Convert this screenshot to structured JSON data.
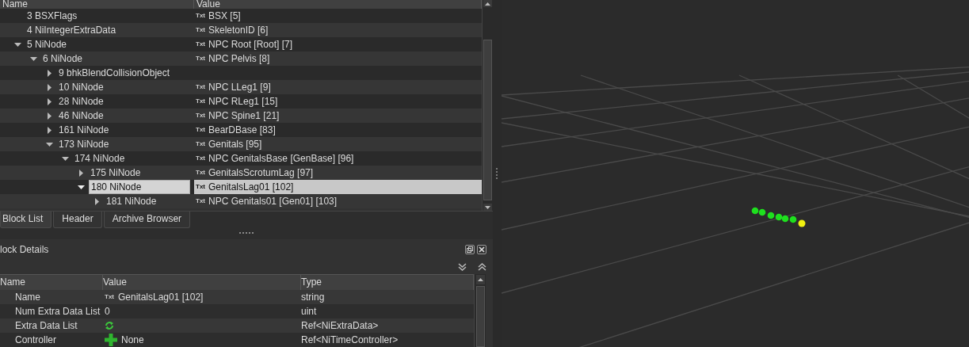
{
  "block_tree": {
    "columns": [
      "Name",
      "Value"
    ],
    "rows": [
      {
        "name": "3 BSXFlags",
        "tag": "Txt",
        "value": "BSX [5]",
        "selected": false
      },
      {
        "name": "4 NiIntegerExtraData",
        "tag": "Txt",
        "value": "SkeletonID [6]",
        "selected": false
      },
      {
        "name": "5 NiNode",
        "tag": "Txt",
        "value": "NPC Root [Root] [7]",
        "selected": false,
        "expanded": true,
        "children": [
          {
            "name": "6 NiNode",
            "tag": "Txt",
            "value": "NPC Pelvis [8]",
            "selected": false,
            "expanded": true,
            "children": [
              {
                "name": "9 bhkBlendCollisionObject",
                "selected": false,
                "expanded": false
              },
              {
                "name": "10 NiNode",
                "tag": "Txt",
                "value": "NPC LLeg1 [9]",
                "selected": false,
                "expanded": false
              },
              {
                "name": "28 NiNode",
                "tag": "Txt",
                "value": "NPC RLeg1 [15]",
                "selected": false,
                "expanded": false
              },
              {
                "name": "46 NiNode",
                "tag": "Txt",
                "value": "NPC Spine1 [21]",
                "selected": false,
                "expanded": false
              },
              {
                "name": "161 NiNode",
                "tag": "Txt",
                "value": "BearDBase [83]",
                "selected": false,
                "expanded": false
              },
              {
                "name": "173 NiNode",
                "tag": "Txt",
                "value": "Genitals [95]",
                "selected": false,
                "expanded": true,
                "children": [
                  {
                    "name": "174 NiNode",
                    "tag": "Txt",
                    "value": "NPC GenitalsBase [GenBase] [96]",
                    "selected": false,
                    "expanded": true,
                    "children": [
                      {
                        "name": "175 NiNode",
                        "tag": "Txt",
                        "value": "GenitalsScrotumLag [97]",
                        "selected": false,
                        "expanded": false
                      },
                      {
                        "name": "180 NiNode",
                        "tag": "Txt",
                        "value": "GenitalsLag01 [102]",
                        "selected": true,
                        "expanded": true,
                        "children": [
                          {
                            "name": "181 NiNode",
                            "tag": "Txt",
                            "value": "NPC Genitals01 [Gen01] [103]",
                            "selected": false,
                            "expanded": false
                          }
                        ]
                      }
                    ]
                  }
                ]
              }
            ]
          }
        ]
      }
    ]
  },
  "tabs": [
    {
      "label": "Block List",
      "selected": true
    },
    {
      "label": "Header",
      "selected": false
    },
    {
      "label": "Archive Browser",
      "selected": false
    }
  ],
  "block_details": {
    "title": "lock Details",
    "columns": [
      "Name",
      "Value",
      "Type"
    ],
    "rows": [
      {
        "name": "Name",
        "kind": "text",
        "tag": "Txt",
        "value": "GenitalsLag01 [102]",
        "type": "string"
      },
      {
        "name": "Num Extra Data List",
        "kind": "text",
        "value": "0",
        "type": "uint"
      },
      {
        "name": "Extra Data List",
        "kind": "refresh",
        "type": "Ref<NiExtraData>"
      },
      {
        "name": "Controller",
        "kind": "add",
        "value": "None",
        "type": "Ref<NiTimeController>"
      }
    ]
  }
}
